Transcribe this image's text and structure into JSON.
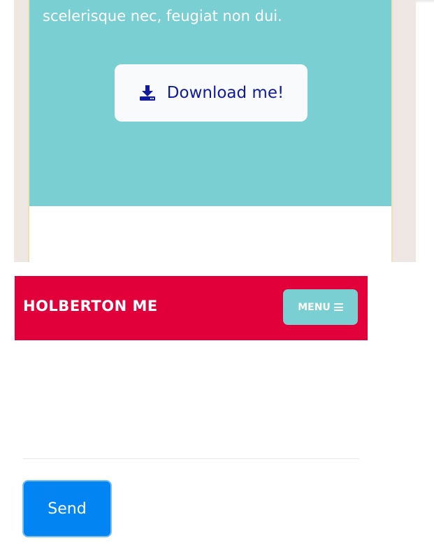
{
  "hero": {
    "text": "scelerisque nec, feugiat non dui.",
    "download_label": "Download me!",
    "download_icon": "download-icon"
  },
  "navbar": {
    "brand": "HOLBERTON ME",
    "menu_label": "MENU",
    "menu_icon": "hamburger-menu-icon"
  },
  "form": {
    "send_label": "Send"
  },
  "colors": {
    "hero_background": "#7acfd3",
    "navbar_background": "#e1003a",
    "menu_button_background": "#7acfd3",
    "download_text": "#111a9d",
    "send_button_background": "#0285f3"
  }
}
